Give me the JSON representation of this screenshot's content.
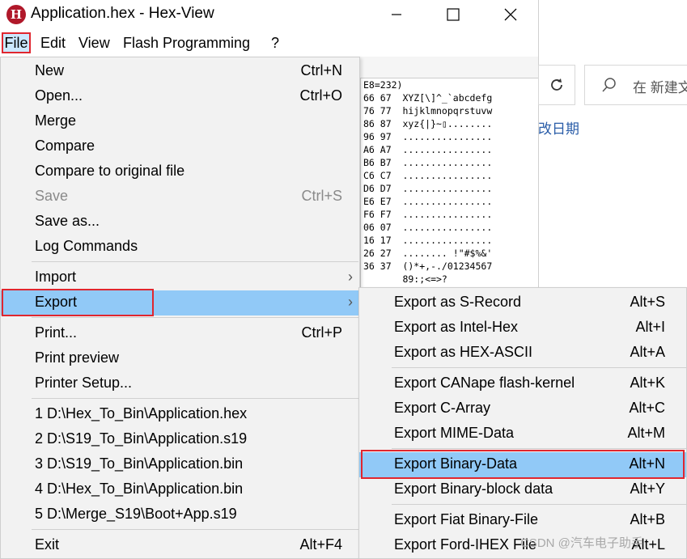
{
  "window": {
    "title": "Application.hex - Hex-View",
    "icon_letter": "H",
    "buttons": [
      "minimize",
      "maximize",
      "close"
    ]
  },
  "menubar": [
    "File",
    "Edit",
    "View",
    "Flash Programming",
    "?"
  ],
  "hexview": {
    "header": "E8=232)",
    "lines": [
      "66 67  XYZ[\\]^_`abcdefg",
      "76 77  hijklmnopqrstuvw",
      "86 87  xyz{|}~▯........",
      "96 97  ................",
      "A6 A7  ................",
      "B6 B7  ................",
      "C6 C7  ................",
      "D6 D7  ................",
      "E6 E7  ................",
      "F6 F7  ................",
      "06 07  ................",
      "16 17  ................",
      "26 27  ........ !\"#$%&'",
      "36 37  ()*+,-./01234567",
      "       89:;<=>?"
    ]
  },
  "explorer": {
    "search_placeholder": "在 新建文",
    "column_header": "改日期",
    "refresh_icon": "refresh-icon",
    "search_icon": "search-icon"
  },
  "file_menu": {
    "items": [
      {
        "label": "New",
        "shortcut": "Ctrl+N"
      },
      {
        "label": "Open...",
        "shortcut": "Ctrl+O"
      },
      {
        "label": "Merge",
        "shortcut": ""
      },
      {
        "label": "Compare",
        "shortcut": ""
      },
      {
        "label": "Compare to original file",
        "shortcut": ""
      },
      {
        "label": "Save",
        "shortcut": "Ctrl+S",
        "disabled": true
      },
      {
        "label": "Save as...",
        "shortcut": ""
      },
      {
        "label": "Log Commands",
        "shortcut": ""
      },
      {
        "label": "Import",
        "shortcut": "",
        "submenu": true
      },
      {
        "label": "Export",
        "shortcut": "",
        "submenu": true,
        "selected": true
      },
      {
        "label": "Print...",
        "shortcut": "Ctrl+P"
      },
      {
        "label": "Print preview",
        "shortcut": ""
      },
      {
        "label": "Printer Setup...",
        "shortcut": ""
      },
      {
        "label": "1 D:\\Hex_To_Bin\\Application.hex",
        "shortcut": ""
      },
      {
        "label": "2 D:\\S19_To_Bin\\Application.s19",
        "shortcut": ""
      },
      {
        "label": "3 D:\\S19_To_Bin\\Application.bin",
        "shortcut": ""
      },
      {
        "label": "4 D:\\Hex_To_Bin\\Application.bin",
        "shortcut": ""
      },
      {
        "label": "5 D:\\Merge_S19\\Boot+App.s19",
        "shortcut": ""
      },
      {
        "label": "Exit",
        "shortcut": "Alt+F4"
      }
    ]
  },
  "export_menu": {
    "items": [
      {
        "label": "Export as S-Record",
        "shortcut": "Alt+S"
      },
      {
        "label": "Export as Intel-Hex",
        "shortcut": "Alt+I"
      },
      {
        "label": "Export as HEX-ASCII",
        "shortcut": "Alt+A"
      },
      {
        "label": "Export CANape flash-kernel",
        "shortcut": "Alt+K"
      },
      {
        "label": "Export C-Array",
        "shortcut": "Alt+C"
      },
      {
        "label": "Export MIME-Data",
        "shortcut": "Alt+M"
      },
      {
        "label": "Export Binary-Data",
        "shortcut": "Alt+N",
        "selected": true
      },
      {
        "label": "Export Binary-block data",
        "shortcut": "Alt+Y"
      },
      {
        "label": "Export Fiat Binary-File",
        "shortcut": "Alt+B"
      },
      {
        "label": "Export Ford-IHEX File",
        "shortcut": "Alt+L"
      }
    ]
  },
  "watermark": "CSDN @汽车电子助手",
  "colors": {
    "highlight": "#91c9f7",
    "callout_border": "#e0262f",
    "menu_bg": "#f2f2f2",
    "app_icon": "#b0182a"
  }
}
